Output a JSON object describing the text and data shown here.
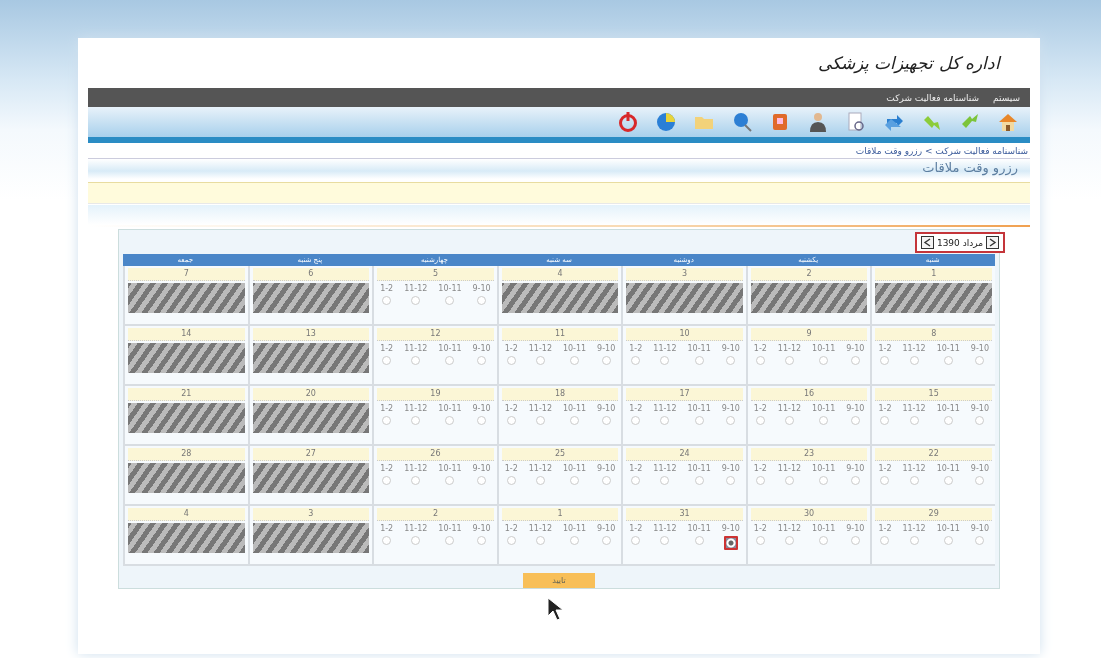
{
  "logo": {
    "text": "اداره کل تجهیزات پزشکی"
  },
  "menu": [
    {
      "label": "سیستم"
    },
    {
      "label": "شناسنامه فعالیت شرکت"
    }
  ],
  "breadcrumb": "شناسنامه فعالیت شرکت > رزرو وقت ملاقات",
  "page_title": "رزرو وقت ملاقات",
  "calendar": {
    "month": "مرداد 1390",
    "weekdays": [
      "شنبه",
      "یکشنبه",
      "دوشنبه",
      "سه شنبه",
      "چهارشنبه",
      "پنج شنبه",
      "جمعه"
    ],
    "days": [
      {
        "day": "7",
        "kind": "closed"
      },
      {
        "day": "6",
        "kind": "closed"
      },
      {
        "day": "5",
        "kind": "open",
        "slots": [
          {
            "label": "1-2",
            "selected": false
          },
          {
            "label": "11-12",
            "selected": false
          },
          {
            "label": "10-11",
            "selected": false
          },
          {
            "label": "9-10",
            "selected": false
          }
        ]
      },
      {
        "day": "4",
        "kind": "closed"
      },
      {
        "day": "3",
        "kind": "closed"
      },
      {
        "day": "2",
        "kind": "closed"
      },
      {
        "day": "1",
        "kind": "closed"
      },
      {
        "day": "14",
        "kind": "closed"
      },
      {
        "day": "13",
        "kind": "closed"
      },
      {
        "day": "12",
        "kind": "open",
        "slots": [
          {
            "label": "1-2",
            "selected": false
          },
          {
            "label": "11-12",
            "selected": false
          },
          {
            "label": "10-11",
            "selected": false
          },
          {
            "label": "9-10",
            "selected": false
          }
        ]
      },
      {
        "day": "11",
        "kind": "open",
        "slots": [
          {
            "label": "1-2",
            "selected": false
          },
          {
            "label": "11-12",
            "selected": false
          },
          {
            "label": "10-11",
            "selected": false
          },
          {
            "label": "9-10",
            "selected": false
          }
        ]
      },
      {
        "day": "10",
        "kind": "open",
        "slots": [
          {
            "label": "1-2",
            "selected": false
          },
          {
            "label": "11-12",
            "selected": false
          },
          {
            "label": "10-11",
            "selected": false
          },
          {
            "label": "9-10",
            "selected": false
          }
        ]
      },
      {
        "day": "9",
        "kind": "open",
        "slots": [
          {
            "label": "1-2",
            "selected": false
          },
          {
            "label": "11-12",
            "selected": false
          },
          {
            "label": "10-11",
            "selected": false
          },
          {
            "label": "9-10",
            "selected": false
          }
        ]
      },
      {
        "day": "8",
        "kind": "open",
        "slots": [
          {
            "label": "1-2",
            "selected": false
          },
          {
            "label": "11-12",
            "selected": false
          },
          {
            "label": "10-11",
            "selected": false
          },
          {
            "label": "9-10",
            "selected": false
          }
        ]
      },
      {
        "day": "21",
        "kind": "closed"
      },
      {
        "day": "20",
        "kind": "closed"
      },
      {
        "day": "19",
        "kind": "open",
        "slots": [
          {
            "label": "1-2",
            "selected": false
          },
          {
            "label": "11-12",
            "selected": false
          },
          {
            "label": "10-11",
            "selected": false
          },
          {
            "label": "9-10",
            "selected": false
          }
        ]
      },
      {
        "day": "18",
        "kind": "open",
        "slots": [
          {
            "label": "1-2",
            "selected": false
          },
          {
            "label": "11-12",
            "selected": false
          },
          {
            "label": "10-11",
            "selected": false
          },
          {
            "label": "9-10",
            "selected": false
          }
        ]
      },
      {
        "day": "17",
        "kind": "open",
        "slots": [
          {
            "label": "1-2",
            "selected": false
          },
          {
            "label": "11-12",
            "selected": false
          },
          {
            "label": "10-11",
            "selected": false
          },
          {
            "label": "9-10",
            "selected": false
          }
        ]
      },
      {
        "day": "16",
        "kind": "open",
        "slots": [
          {
            "label": "1-2",
            "selected": false
          },
          {
            "label": "11-12",
            "selected": false
          },
          {
            "label": "10-11",
            "selected": false
          },
          {
            "label": "9-10",
            "selected": false
          }
        ]
      },
      {
        "day": "15",
        "kind": "open",
        "slots": [
          {
            "label": "1-2",
            "selected": false
          },
          {
            "label": "11-12",
            "selected": false
          },
          {
            "label": "10-11",
            "selected": false
          },
          {
            "label": "9-10",
            "selected": false
          }
        ]
      },
      {
        "day": "28",
        "kind": "closed"
      },
      {
        "day": "27",
        "kind": "closed"
      },
      {
        "day": "26",
        "kind": "open",
        "slots": [
          {
            "label": "1-2",
            "selected": false
          },
          {
            "label": "11-12",
            "selected": false
          },
          {
            "label": "10-11",
            "selected": false
          },
          {
            "label": "9-10",
            "selected": false
          }
        ]
      },
      {
        "day": "25",
        "kind": "open",
        "slots": [
          {
            "label": "1-2",
            "selected": false
          },
          {
            "label": "11-12",
            "selected": false
          },
          {
            "label": "10-11",
            "selected": false
          },
          {
            "label": "9-10",
            "selected": false
          }
        ]
      },
      {
        "day": "24",
        "kind": "open",
        "slots": [
          {
            "label": "1-2",
            "selected": false
          },
          {
            "label": "11-12",
            "selected": false
          },
          {
            "label": "10-11",
            "selected": false
          },
          {
            "label": "9-10",
            "selected": false
          }
        ]
      },
      {
        "day": "23",
        "kind": "open",
        "slots": [
          {
            "label": "1-2",
            "selected": false
          },
          {
            "label": "11-12",
            "selected": false
          },
          {
            "label": "10-11",
            "selected": false
          },
          {
            "label": "9-10",
            "selected": false
          }
        ]
      },
      {
        "day": "22",
        "kind": "open",
        "slots": [
          {
            "label": "1-2",
            "selected": false
          },
          {
            "label": "11-12",
            "selected": false
          },
          {
            "label": "10-11",
            "selected": false
          },
          {
            "label": "9-10",
            "selected": false
          }
        ]
      },
      {
        "day": "4",
        "kind": "closed"
      },
      {
        "day": "3",
        "kind": "closed"
      },
      {
        "day": "2",
        "kind": "open",
        "slots": [
          {
            "label": "1-2",
            "selected": false
          },
          {
            "label": "11-12",
            "selected": false
          },
          {
            "label": "10-11",
            "selected": false
          },
          {
            "label": "9-10",
            "selected": false
          }
        ]
      },
      {
        "day": "1",
        "kind": "open",
        "slots": [
          {
            "label": "1-2",
            "selected": false
          },
          {
            "label": "11-12",
            "selected": false
          },
          {
            "label": "10-11",
            "selected": false
          },
          {
            "label": "9-10",
            "selected": false
          }
        ]
      },
      {
        "day": "31",
        "kind": "open",
        "slots": [
          {
            "label": "1-2",
            "selected": false
          },
          {
            "label": "11-12",
            "selected": false
          },
          {
            "label": "10-11",
            "selected": false
          },
          {
            "label": "9-10",
            "selected": true
          }
        ]
      },
      {
        "day": "30",
        "kind": "open",
        "slots": [
          {
            "label": "1-2",
            "selected": false
          },
          {
            "label": "11-12",
            "selected": false
          },
          {
            "label": "10-11",
            "selected": false
          },
          {
            "label": "9-10",
            "selected": false
          }
        ]
      },
      {
        "day": "29",
        "kind": "open",
        "slots": [
          {
            "label": "1-2",
            "selected": false
          },
          {
            "label": "11-12",
            "selected": false
          },
          {
            "label": "10-11",
            "selected": false
          },
          {
            "label": "9-10",
            "selected": false
          }
        ]
      }
    ]
  },
  "confirm_button": "تایید"
}
